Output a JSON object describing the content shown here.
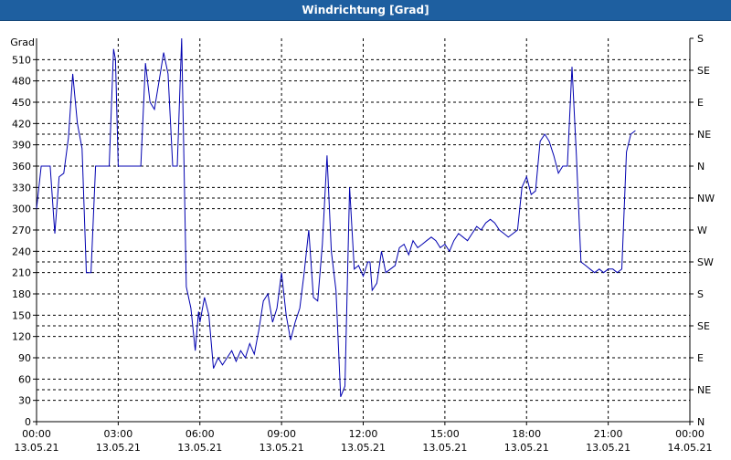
{
  "window": {
    "title": "Windrichtung [Grad]"
  },
  "chart_data": {
    "type": "line",
    "title": "Windrichtung [Grad]",
    "ylabel": "Grad",
    "ylim": [
      0,
      540
    ],
    "yticks": [
      0,
      30,
      60,
      90,
      120,
      150,
      180,
      210,
      240,
      270,
      300,
      330,
      360,
      390,
      420,
      450,
      480,
      510
    ],
    "right_axis_ticks": [
      {
        "value": 0,
        "label": "N"
      },
      {
        "value": 45,
        "label": "NE"
      },
      {
        "value": 90,
        "label": "E"
      },
      {
        "value": 135,
        "label": "SE"
      },
      {
        "value": 180,
        "label": "S"
      },
      {
        "value": 225,
        "label": "SW"
      },
      {
        "value": 270,
        "label": "W"
      },
      {
        "value": 315,
        "label": "NW"
      },
      {
        "value": 360,
        "label": "N"
      },
      {
        "value": 405,
        "label": "NE"
      },
      {
        "value": 450,
        "label": "E"
      },
      {
        "value": 495,
        "label": "SE"
      },
      {
        "value": 540,
        "label": "S"
      }
    ],
    "xlim": [
      0,
      24
    ],
    "xticks": [
      {
        "hours": 0,
        "time": "00:00",
        "date": "13.05.21"
      },
      {
        "hours": 3,
        "time": "03:00",
        "date": "13.05.21"
      },
      {
        "hours": 6,
        "time": "06:00",
        "date": "13.05.21"
      },
      {
        "hours": 9,
        "time": "09:00",
        "date": "13.05.21"
      },
      {
        "hours": 12,
        "time": "12:00",
        "date": "13.05.21"
      },
      {
        "hours": 15,
        "time": "15:00",
        "date": "13.05.21"
      },
      {
        "hours": 18,
        "time": "18:00",
        "date": "13.05.21"
      },
      {
        "hours": 21,
        "time": "21:00",
        "date": "13.05.21"
      },
      {
        "hours": 24,
        "time": "00:00",
        "date": "14.05.21"
      }
    ],
    "grid": true,
    "line_color": "#0000b0",
    "x": [
      0.0,
      0.17,
      0.33,
      0.5,
      0.67,
      0.83,
      1.0,
      1.17,
      1.33,
      1.5,
      1.67,
      1.83,
      2.0,
      2.1,
      2.17,
      2.33,
      2.5,
      2.67,
      2.83,
      2.9,
      3.0,
      3.1,
      3.17,
      3.33,
      3.5,
      3.67,
      3.83,
      4.0,
      4.17,
      4.33,
      4.5,
      4.67,
      4.83,
      5.0,
      5.17,
      5.33,
      5.5,
      5.67,
      5.83,
      5.95,
      6.0,
      6.17,
      6.33,
      6.5,
      6.67,
      6.83,
      7.0,
      7.17,
      7.33,
      7.5,
      7.67,
      7.83,
      8.0,
      8.17,
      8.33,
      8.5,
      8.67,
      8.83,
      9.0,
      9.17,
      9.33,
      9.5,
      9.67,
      9.83,
      10.0,
      10.17,
      10.33,
      10.5,
      10.67,
      10.83,
      11.0,
      11.17,
      11.33,
      11.5,
      11.67,
      11.83,
      12.0,
      12.17,
      12.25,
      12.33,
      12.5,
      12.67,
      12.83,
      13.0,
      13.17,
      13.33,
      13.5,
      13.67,
      13.83,
      14.0,
      14.17,
      14.33,
      14.5,
      14.67,
      14.83,
      15.0,
      15.17,
      15.33,
      15.5,
      15.67,
      15.83,
      16.0,
      16.17,
      16.33,
      16.5,
      16.67,
      16.83,
      17.0,
      17.17,
      17.33,
      17.5,
      17.67,
      17.83,
      18.0,
      18.17,
      18.33,
      18.5,
      18.67,
      18.83,
      19.0,
      19.17,
      19.33,
      19.5,
      19.67,
      19.83,
      20.0,
      20.17,
      20.33,
      20.5,
      20.67,
      20.83,
      21.0,
      21.17,
      21.33,
      21.5,
      21.67,
      21.83,
      22.0,
      22.17,
      22.33,
      22.5,
      22.67,
      22.83,
      23.0,
      23.17,
      23.33,
      23.5,
      23.67,
      23.83,
      24.0
    ],
    "y": [
      300,
      360,
      360,
      360,
      265,
      345,
      350,
      400,
      490,
      420,
      385,
      210,
      210,
      300,
      360,
      360,
      360,
      360,
      525,
      510,
      360,
      360,
      360,
      360,
      360,
      360,
      360,
      505,
      450,
      440,
      480,
      520,
      490,
      360,
      360,
      540,
      190,
      160,
      100,
      155,
      140,
      175,
      150,
      75,
      90,
      80,
      90,
      100,
      85,
      100,
      90,
      110,
      95,
      130,
      170,
      180,
      140,
      160,
      210,
      150,
      115,
      140,
      160,
      210,
      270,
      175,
      170,
      250,
      375,
      240,
      185,
      35,
      50,
      330,
      215,
      220,
      205,
      225,
      225,
      185,
      195,
      240,
      210,
      215,
      220,
      245,
      250,
      235,
      255,
      245,
      250,
      255,
      260,
      255,
      245,
      250,
      240,
      255,
      265,
      260,
      255,
      265,
      275,
      270,
      280,
      285,
      280,
      270,
      265,
      260,
      265,
      270,
      330,
      345,
      320,
      325,
      395,
      405,
      395,
      375,
      350,
      360,
      360,
      500,
      375,
      225,
      220,
      215,
      210,
      215,
      210,
      215,
      215,
      210,
      215,
      380,
      405,
      410
    ]
  }
}
